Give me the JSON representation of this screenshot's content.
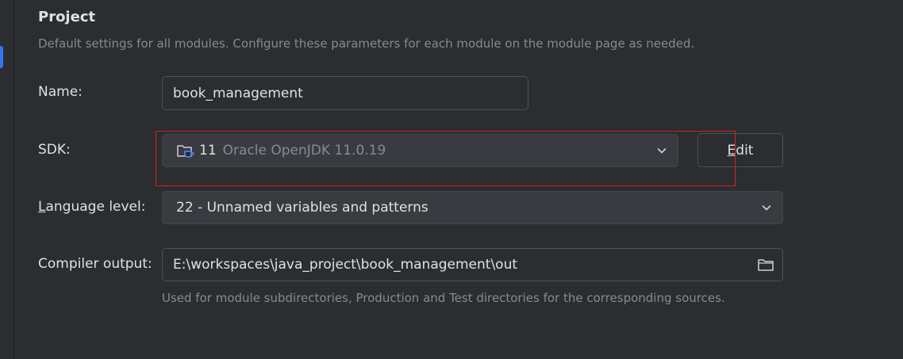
{
  "section": {
    "title": "Project",
    "description": "Default settings for all modules. Configure these parameters for each module on the module page as needed."
  },
  "name": {
    "label": "Name:",
    "value": "book_management"
  },
  "sdk": {
    "label": "SDK:",
    "version": "11",
    "detail": "Oracle OpenJDK 11.0.19",
    "icon": "jdk-folder-icon",
    "edit_mnemonic": "E",
    "edit_rest": "dit"
  },
  "language_level": {
    "label_mnemonic": "L",
    "label_rest": "anguage level:",
    "value": "22 - Unnamed variables and patterns"
  },
  "compiler_output": {
    "label": "Compiler output:",
    "value": "E:\\workspaces\\java_project\\book_management\\out",
    "hint": "Used for module subdirectories, Production and Test directories for the corresponding sources."
  },
  "colors": {
    "background": "#2b2d30",
    "accent": "#3574f0",
    "highlight_box": "#d3202a"
  }
}
